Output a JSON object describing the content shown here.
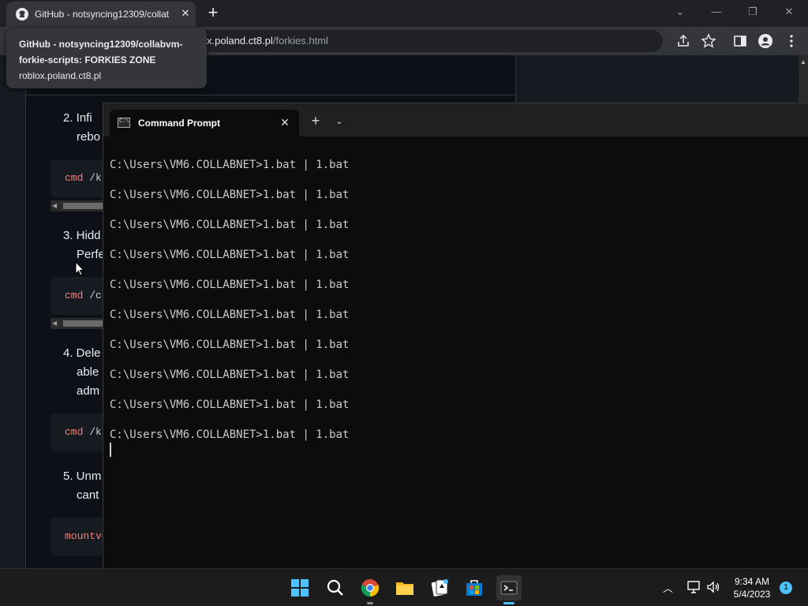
{
  "browser": {
    "tab_title": "GitHub - notsyncing12309/collat",
    "url_domain": "x.poland.ct8.pl",
    "url_path": "/forkies.html",
    "hover_title_line1": "GitHub - notsyncing12309/collabvm-",
    "hover_title_line2": "forkie-scripts: FORKIES ZONE",
    "hover_domain": "roblox.poland.ct8.pl"
  },
  "article": {
    "items": [
      {
        "l1": "2. Infi",
        "l2": "rebo"
      },
      {
        "l1": "3. Hidd",
        "l2": "Perfe"
      },
      {
        "l1": "4. Dele",
        "l2": "able",
        "l3": "adm"
      },
      {
        "l1": "5. Unm",
        "l2": "cant"
      }
    ],
    "code": [
      {
        "cmd": "cmd",
        "arg": " /k"
      },
      {
        "cmd": "cmd",
        "arg": " /c"
      },
      {
        "cmd": "cmd",
        "arg": " /k"
      },
      {
        "cmd": "mountvo",
        "arg": ""
      }
    ]
  },
  "terminal": {
    "tab_title": "Command Prompt",
    "icon_text": "C:\\",
    "lines": [
      "C:\\Users\\VM6.COLLABNET>1.bat | 1.bat",
      "C:\\Users\\VM6.COLLABNET>1.bat | 1.bat",
      "C:\\Users\\VM6.COLLABNET>1.bat | 1.bat",
      "C:\\Users\\VM6.COLLABNET>1.bat | 1.bat",
      "C:\\Users\\VM6.COLLABNET>1.bat | 1.bat",
      "C:\\Users\\VM6.COLLABNET>1.bat | 1.bat",
      "C:\\Users\\VM6.COLLABNET>1.bat | 1.bat",
      "C:\\Users\\VM6.COLLABNET>1.bat | 1.bat",
      "C:\\Users\\VM6.COLLABNET>1.bat | 1.bat",
      "C:\\Users\\VM6.COLLABNET>1.bat | 1.bat"
    ]
  },
  "taskbar": {
    "time": "9:34 AM",
    "date": "5/4/2023",
    "notification_count": "1",
    "icons": [
      "windows-start-icon",
      "search-icon",
      "chrome-icon",
      "file-explorer-icon",
      "solitaire-icon",
      "store-icon",
      "terminal-icon"
    ]
  },
  "colors": {
    "accent": "#4cc2ff",
    "code_keyword": "#ff7b72",
    "terminal_bg": "#0c0c0c"
  }
}
